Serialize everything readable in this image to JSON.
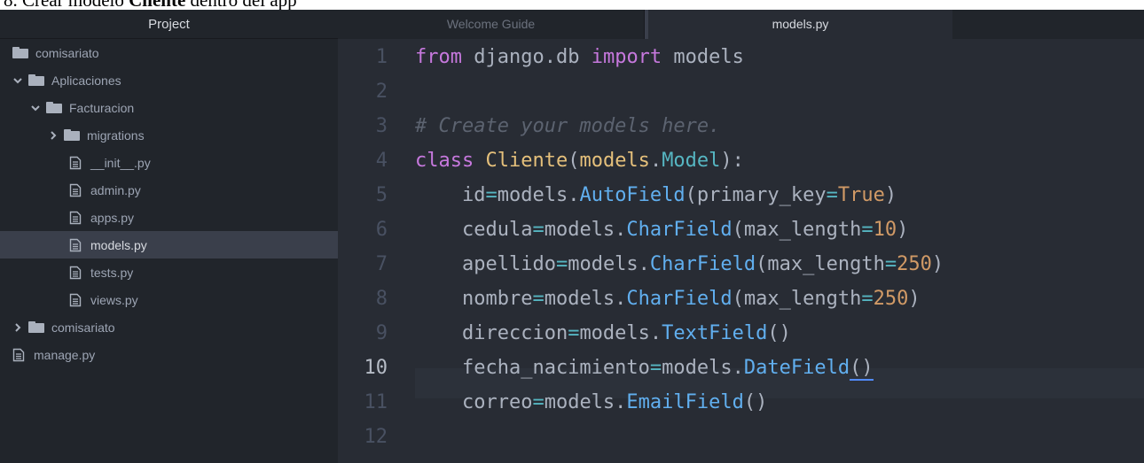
{
  "heading": {
    "prefix": "8. Crear modelo ",
    "bold": "Cliente",
    "suffix": " dentro del app"
  },
  "sidebar": {
    "title": "Project",
    "items": [
      {
        "label": "comisariato",
        "type": "folder",
        "expanded": null
      },
      {
        "label": "Aplicaciones",
        "type": "folder",
        "expanded": true
      },
      {
        "label": "Facturacion",
        "type": "folder",
        "expanded": true
      },
      {
        "label": "migrations",
        "type": "folder",
        "expanded": false
      },
      {
        "label": "__init__.py",
        "type": "file"
      },
      {
        "label": "admin.py",
        "type": "file"
      },
      {
        "label": "apps.py",
        "type": "file"
      },
      {
        "label": "models.py",
        "type": "file",
        "selected": true
      },
      {
        "label": "tests.py",
        "type": "file"
      },
      {
        "label": "views.py",
        "type": "file"
      },
      {
        "label": "comisariato",
        "type": "folder",
        "expanded": false
      },
      {
        "label": "manage.py",
        "type": "file"
      }
    ]
  },
  "tabs": [
    {
      "label": "Welcome Guide",
      "active": false
    },
    {
      "label": "models.py",
      "active": true
    }
  ],
  "editor": {
    "active_line": 10,
    "line_numbers": [
      "1",
      "2",
      "3",
      "4",
      "5",
      "6",
      "7",
      "8",
      "9",
      "10",
      "11",
      "12"
    ],
    "lines": [
      "from django.db import models",
      "",
      "# Create your models here.",
      "class Cliente(models.Model):",
      "    id=models.AutoField(primary_key=True)",
      "    cedula=models.CharField(max_length=10)",
      "    apellido=models.CharField(max_length=250)",
      "    nombre=models.CharField(max_length=250)",
      "    direccion=models.TextField()",
      "    fecha_nacimiento=models.DateField()",
      "    correo=models.EmailField()",
      ""
    ]
  },
  "colors": {
    "background": "#282c34",
    "sidebar": "#21252b",
    "keyword": "#c678dd",
    "class": "#e5c07b",
    "function": "#61afef",
    "operator": "#56b6c2",
    "number": "#d19a66",
    "comment": "#5c6370"
  }
}
